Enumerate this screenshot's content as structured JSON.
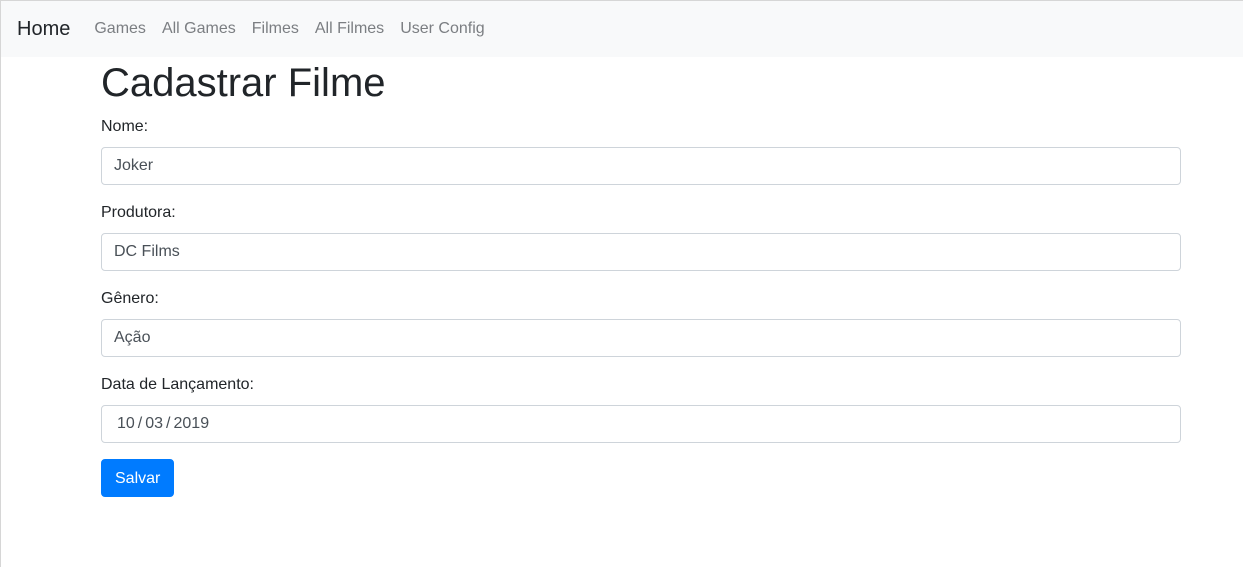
{
  "navbar": {
    "brand": "Home",
    "links": [
      "Games",
      "All Games",
      "Filmes",
      "All Filmes",
      "User Config"
    ]
  },
  "page": {
    "title": "Cadastrar Filme"
  },
  "form": {
    "nome": {
      "label": "Nome:",
      "value": "Joker"
    },
    "produtora": {
      "label": "Produtora:",
      "value": "DC Films"
    },
    "genero": {
      "label": "Gênero:",
      "value": "Ação"
    },
    "data_lancamento": {
      "label": "Data de Lançamento:",
      "day": "10",
      "month": "03",
      "year": "2019",
      "separator": "/"
    },
    "submit_label": "Salvar"
  },
  "colors": {
    "navbar_bg": "#f8f9fa",
    "primary": "#007bff",
    "nav_link": "#7b7e82"
  }
}
